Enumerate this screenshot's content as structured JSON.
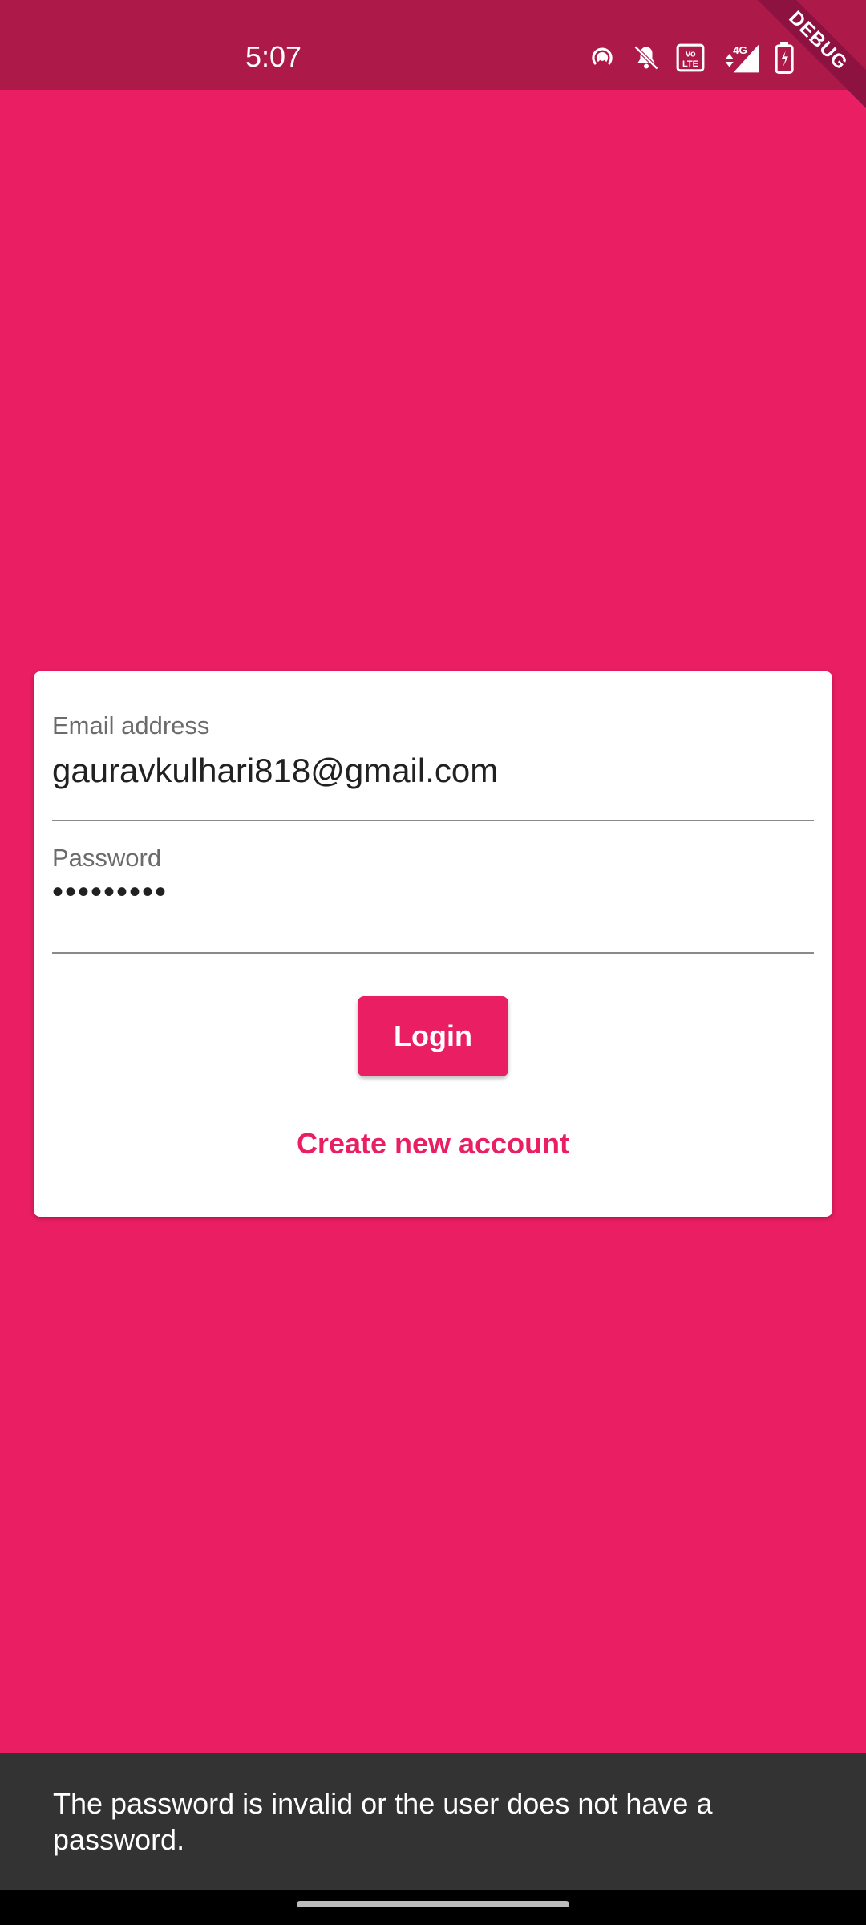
{
  "status_bar": {
    "time": "5:07",
    "icons": [
      "hotspot-icon",
      "bell-off-icon",
      "volte-icon",
      "signal-4g-icon",
      "battery-charging-icon"
    ],
    "network_label": "4G"
  },
  "debug_banner": "DEBUG",
  "login_form": {
    "email_label": "Email address",
    "email_value": "gauravkulhari818@gmail.com",
    "password_label": "Password",
    "password_value": "•••••••••",
    "login_button": "Login",
    "create_account_link": "Create new account"
  },
  "snackbar": {
    "message": "The password is invalid or the user does not have a password."
  },
  "colors": {
    "primary": "#E91E63",
    "status_bar": "#AD1A4A",
    "snackbar": "#333333"
  }
}
